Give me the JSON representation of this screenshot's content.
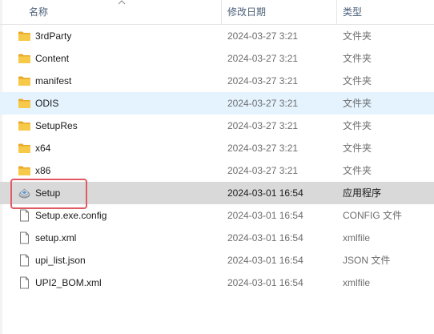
{
  "columns": {
    "name": "名称",
    "date": "修改日期",
    "type": "类型"
  },
  "sort": {
    "column": "name",
    "direction": "ascending"
  },
  "files": [
    {
      "name": "3rdParty",
      "date": "2024-03-27 3:21",
      "type": "文件夹",
      "icon": "folder-icon",
      "state": "normal"
    },
    {
      "name": "Content",
      "date": "2024-03-27 3:21",
      "type": "文件夹",
      "icon": "folder-icon",
      "state": "normal"
    },
    {
      "name": "manifest",
      "date": "2024-03-27 3:21",
      "type": "文件夹",
      "icon": "folder-icon",
      "state": "normal"
    },
    {
      "name": "ODIS",
      "date": "2024-03-27 3:21",
      "type": "文件夹",
      "icon": "folder-icon",
      "state": "hover"
    },
    {
      "name": "SetupRes",
      "date": "2024-03-27 3:21",
      "type": "文件夹",
      "icon": "folder-icon",
      "state": "normal"
    },
    {
      "name": "x64",
      "date": "2024-03-27 3:21",
      "type": "文件夹",
      "icon": "folder-icon",
      "state": "normal"
    },
    {
      "name": "x86",
      "date": "2024-03-27 3:21",
      "type": "文件夹",
      "icon": "folder-icon",
      "state": "normal"
    },
    {
      "name": "Setup",
      "date": "2024-03-01 16:54",
      "type": "应用程序",
      "icon": "setup-app-icon",
      "state": "selected"
    },
    {
      "name": "Setup.exe.config",
      "date": "2024-03-01 16:54",
      "type": "CONFIG 文件",
      "icon": "file-icon",
      "state": "normal"
    },
    {
      "name": "setup.xml",
      "date": "2024-03-01 16:54",
      "type": "xmlfile",
      "icon": "file-icon",
      "state": "normal"
    },
    {
      "name": "upi_list.json",
      "date": "2024-03-01 16:54",
      "type": "JSON 文件",
      "icon": "file-icon",
      "state": "normal"
    },
    {
      "name": "UPI2_BOM.xml",
      "date": "2024-03-01 16:54",
      "type": "xmlfile",
      "icon": "file-icon",
      "state": "normal"
    }
  ],
  "colors": {
    "hover_row": "#e5f3ff",
    "selected_row": "#d9d9d9",
    "highlight_box": "#e05a64",
    "folder": "#f3c24a",
    "header_text": "#4c607a"
  }
}
